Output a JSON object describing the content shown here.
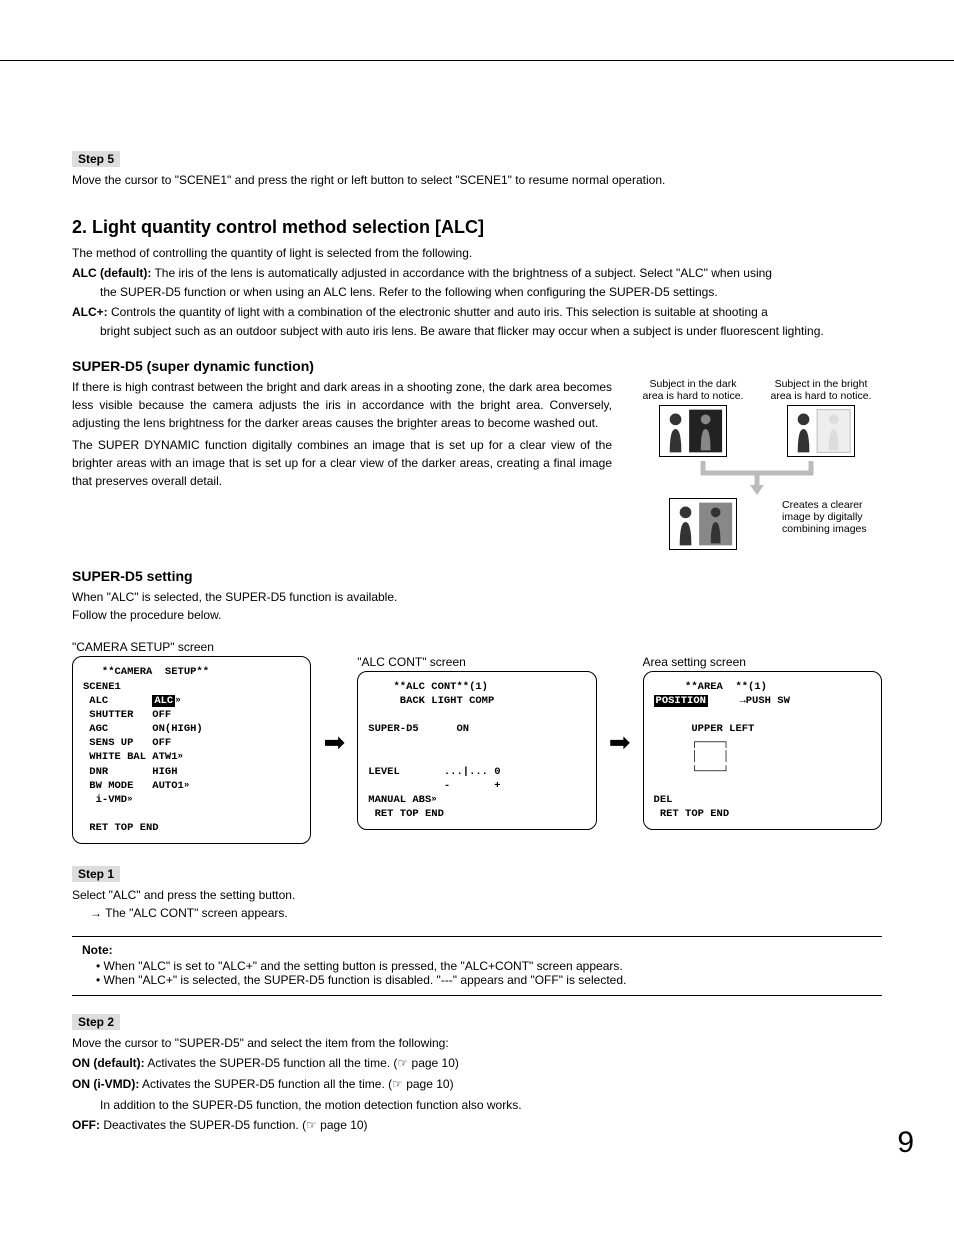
{
  "step5": {
    "badge": "Step 5",
    "text": "Move the cursor to \"SCENE1\" and press the right or left button to select \"SCENE1\" to resume normal operation."
  },
  "section2": {
    "heading": "2. Light quantity control method selection [ALC]",
    "intro": "The method of controlling the quantity of light is selected from the following.",
    "alc_default_term": "ALC (default):",
    "alc_default_line1": " The iris of the lens is automatically adjusted in accordance with the brightness of a subject. Select \"ALC\" when using",
    "alc_default_line2": "the SUPER-D5 function or when using an ALC lens. Refer to the following when configuring the SUPER-D5 settings.",
    "alc_plus_term": "ALC+:",
    "alc_plus_line1": " Controls the quantity of light with a combination of the electronic shutter and auto iris. This selection is suitable at shooting a",
    "alc_plus_line2": "bright subject such as an outdoor subject with auto iris lens. Be aware that flicker may occur when a subject is under fluorescent lighting."
  },
  "superd5": {
    "heading": "SUPER-D5 (super dynamic function)",
    "para1": "If there is high contrast between the bright and dark areas in a shooting zone, the dark area becomes less visible because the camera adjusts the iris in accordance with the bright area. Conversely, adjusting the lens brightness for the darker areas causes the brighter areas to become washed out.",
    "para2": "The SUPER DYNAMIC function digitally combines an image that is set up for a clear view of the brighter areas with an image that is set up for a clear view of the darker areas, creating a final image that preserves overall detail.",
    "diag_label_dark": "Subject in the dark area is hard to notice.",
    "diag_label_bright": "Subject in the bright area is hard to notice.",
    "diag_result": "Creates a clearer image by digitally combining images"
  },
  "superd5_setting": {
    "heading": "SUPER-D5 setting",
    "line1": "When \"ALC\" is selected, the SUPER-D5 function is available.",
    "line2": "Follow the procedure below."
  },
  "screens": {
    "cam_label": "\"CAMERA SETUP\" screen",
    "alc_label": "\"ALC CONT\" screen",
    "area_label": "Area setting screen",
    "cam_title": "   **CAMERA  SETUP**",
    "cam_rows": [
      [
        "SCENE1",
        ""
      ],
      [
        " ALC",
        "ALC\"|"
      ],
      [
        " SHUTTER",
        "OFF"
      ],
      [
        " AGC",
        "ON(HIGH)"
      ],
      [
        " SENS UP",
        "OFF"
      ],
      [
        " WHITE BAL",
        "ATW1\"|"
      ],
      [
        " DNR",
        "HIGH"
      ],
      [
        " BW MODE",
        "AUTO1\"|"
      ],
      [
        " i-VMD\"|",
        ""
      ]
    ],
    "cam_footer": " RET TOP END",
    "alc_title1": "    **ALC CONT**(1)",
    "alc_title2": "     BACK LIGHT COMP",
    "alc_superd5": "SUPER-D5      ON",
    "alc_level": "LEVEL       ...|... 0",
    "alc_pm": "            -       +",
    "alc_manual": "MANUAL ABS\"|",
    "alc_footer": " RET TOP END",
    "area_title": "     **AREA  **(1)",
    "area_pos": "POSITION     →PUSH SW",
    "area_upper": "      UPPER LEFT",
    "area_del": "DEL",
    "area_footer": " RET TOP END"
  },
  "step1": {
    "badge": "Step 1",
    "line1": "Select \"ALC\" and press the setting button.",
    "line2": "→  The \"ALC CONT\" screen appears."
  },
  "note": {
    "label": "Note:",
    "b1": "When \"ALC\" is set to \"ALC+\" and the setting button is pressed, the \"ALC+CONT\" screen appears.",
    "b2": "When \"ALC+\" is selected, the SUPER-D5 function is disabled. \"---\" appears and \"OFF\" is selected."
  },
  "step2": {
    "badge": "Step 2",
    "intro": "Move the cursor to \"SUPER-D5\" and select the item from the following:",
    "on_term": "ON (default):",
    "on_text": " Activates the SUPER-D5 function all the time. (☞ page 10)",
    "onivmd_term": "ON (i-VMD):",
    "onivmd_text": " Activates the SUPER-D5 function all the time. (☞ page 10)",
    "onivmd_extra": "In addition to the SUPER-D5 function, the motion detection function also works.",
    "off_term": "OFF:",
    "off_text": " Deactivates the SUPER-D5 function. (☞ page 10)"
  },
  "page_number": "9"
}
